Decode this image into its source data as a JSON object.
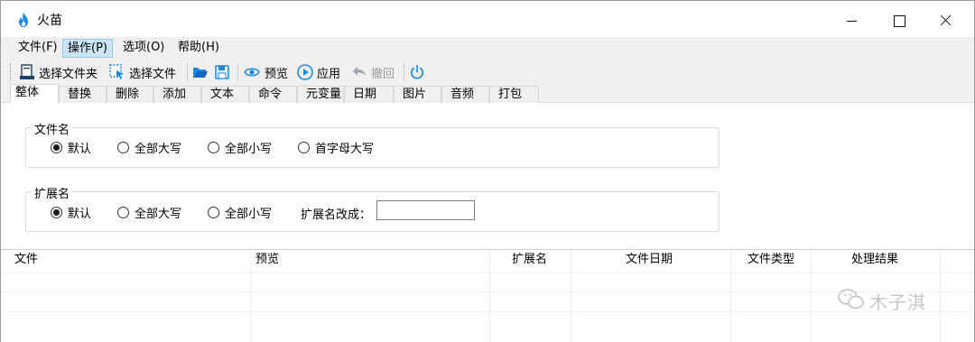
{
  "window": {
    "title": "火苗",
    "accent": "#1e88e5"
  },
  "menu": [
    {
      "label": "文件(F)",
      "active": false
    },
    {
      "label": "操作(P)",
      "active": true
    },
    {
      "label": "选项(O)",
      "active": false
    },
    {
      "label": "帮助(H)",
      "active": false
    }
  ],
  "toolbar": {
    "select_folder": "选择文件夹",
    "select_file": "选择文件",
    "preview": "预览",
    "apply": "应用",
    "undo": "撤回",
    "icons": [
      "folder-select-icon",
      "file-select-icon",
      "open-folder-icon",
      "save-icon",
      "eye-icon",
      "play-icon",
      "undo-icon",
      "power-icon"
    ]
  },
  "tabs": [
    {
      "label": "整体",
      "active": true
    },
    {
      "label": "替换"
    },
    {
      "label": "删除"
    },
    {
      "label": "添加"
    },
    {
      "label": "文本"
    },
    {
      "label": "命令"
    },
    {
      "label": "元变量"
    },
    {
      "label": "日期"
    },
    {
      "label": "图片"
    },
    {
      "label": "音频"
    },
    {
      "label": "打包"
    }
  ],
  "filename_group": {
    "label": "文件名",
    "options": [
      {
        "label": "默认",
        "checked": true
      },
      {
        "label": "全部大写",
        "checked": false
      },
      {
        "label": "全部小写",
        "checked": false
      },
      {
        "label": "首字母大写",
        "checked": false
      }
    ]
  },
  "extension_group": {
    "label": "扩展名",
    "options": [
      {
        "label": "默认",
        "checked": true
      },
      {
        "label": "全部大写",
        "checked": false
      },
      {
        "label": "全部小写",
        "checked": false
      }
    ],
    "change_label": "扩展名改成：",
    "change_value": ""
  },
  "table": {
    "columns": [
      "文件",
      "预览",
      "扩展名",
      "文件日期",
      "文件类型",
      "处理结果"
    ],
    "rows": []
  },
  "watermark": {
    "text": "木子淇"
  }
}
